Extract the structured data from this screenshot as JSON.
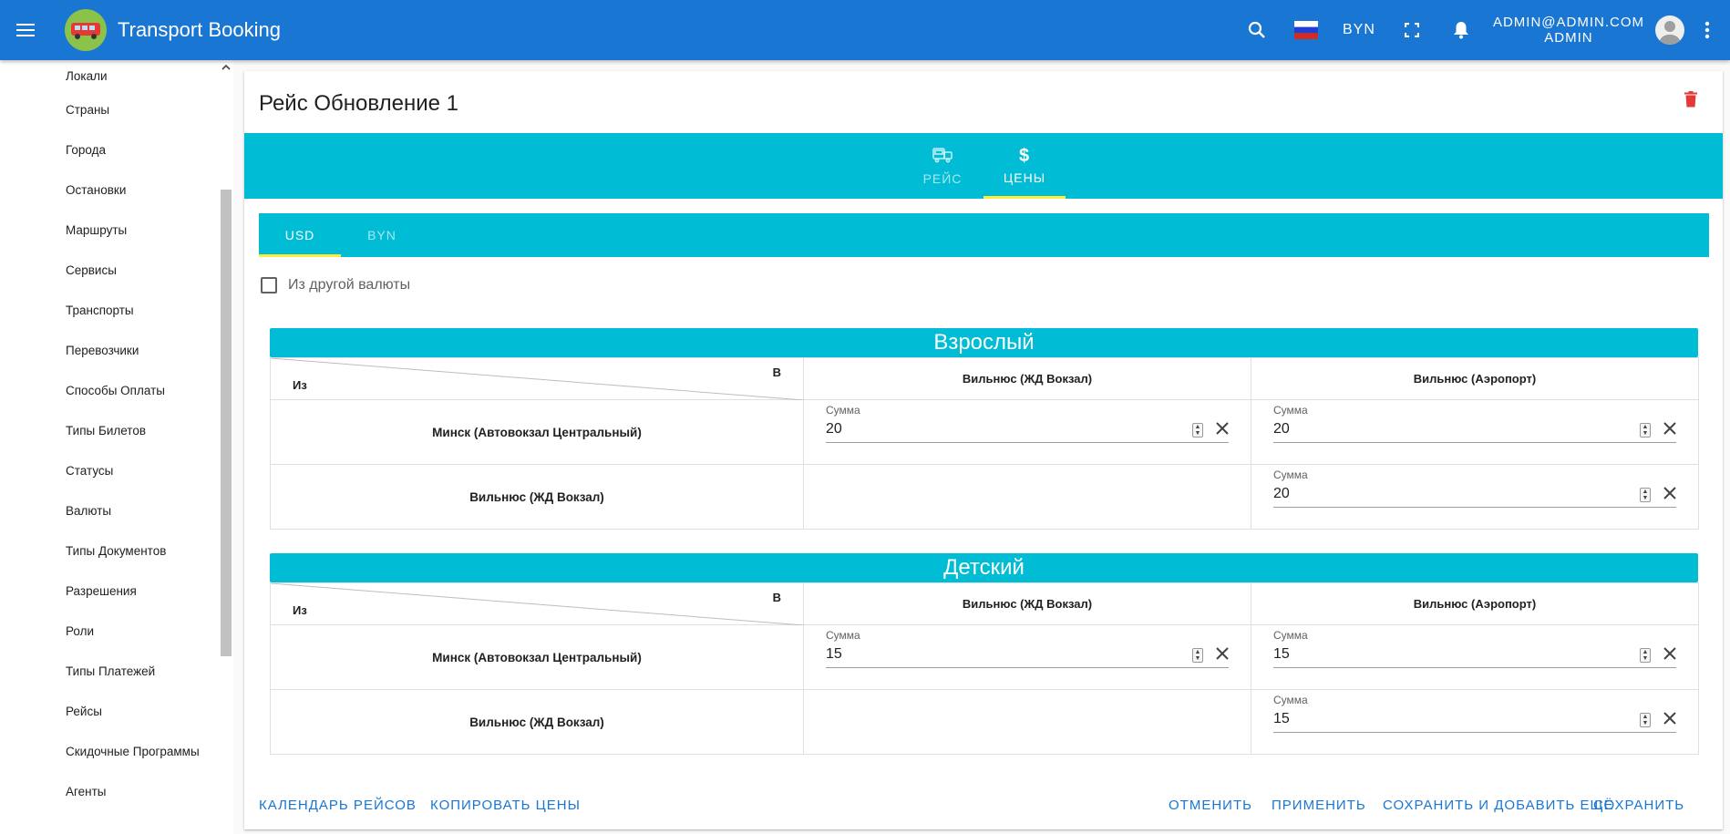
{
  "appbar": {
    "title": "Transport Booking",
    "currency": "BYN",
    "user_email": "ADMIN@ADMIN.COM",
    "user_role": "ADMIN",
    "color": "#1976d2"
  },
  "sidebar": {
    "items": [
      {
        "label": "Локали"
      },
      {
        "label": "Страны"
      },
      {
        "label": "Города"
      },
      {
        "label": "Остановки"
      },
      {
        "label": "Маршруты"
      },
      {
        "label": "Сервисы"
      },
      {
        "label": "Транспорты"
      },
      {
        "label": "Перевозчики"
      },
      {
        "label": "Способы Оплаты"
      },
      {
        "label": "Типы Билетов"
      },
      {
        "label": "Статусы"
      },
      {
        "label": "Валюты"
      },
      {
        "label": "Типы Документов"
      },
      {
        "label": "Разрешения"
      },
      {
        "label": "Роли"
      },
      {
        "label": "Типы Платежей"
      },
      {
        "label": "Рейсы"
      },
      {
        "label": "Скидочные Программы"
      },
      {
        "label": "Агенты"
      }
    ]
  },
  "page": {
    "title": "Рейс Обновление 1",
    "accent": "#00bcd4",
    "ink_color": "#ffeb3b",
    "delete_color": "#e53935"
  },
  "main_tabs": [
    {
      "label": "РЕЙС",
      "icon": "bus-icon",
      "active": false
    },
    {
      "label": "ЦЕНЫ",
      "icon": "dollar-icon",
      "active": true
    }
  ],
  "currency_tabs": [
    {
      "label": "USD",
      "active": true
    },
    {
      "label": "BYN",
      "active": false
    }
  ],
  "from_other_currency": {
    "label": "Из другой валюты",
    "checked": false
  },
  "price_sections": [
    {
      "title": "Взрослый",
      "from_label": "Из",
      "to_label": "В",
      "columns": [
        "Вильнюс (ЖД Вокзал)",
        "Вильнюс (Аэропорт)"
      ],
      "rows": [
        {
          "label": "Минск (Автовокзал Центральный)",
          "cells": [
            {
              "field_label": "Сумма",
              "value": "20"
            },
            {
              "field_label": "Сумма",
              "value": "20"
            }
          ]
        },
        {
          "label": "Вильнюс (ЖД Вокзал)",
          "cells": [
            null,
            {
              "field_label": "Сумма",
              "value": "20"
            }
          ]
        }
      ]
    },
    {
      "title": "Детский",
      "from_label": "Из",
      "to_label": "В",
      "columns": [
        "Вильнюс (ЖД Вокзал)",
        "Вильнюс (Аэропорт)"
      ],
      "rows": [
        {
          "label": "Минск (Автовокзал Центральный)",
          "cells": [
            {
              "field_label": "Сумма",
              "value": "15"
            },
            {
              "field_label": "Сумма",
              "value": "15"
            }
          ]
        },
        {
          "label": "Вильнюс (ЖД Вокзал)",
          "cells": [
            null,
            {
              "field_label": "Сумма",
              "value": "15"
            }
          ]
        }
      ]
    }
  ],
  "actions": {
    "calendar": "КАЛЕНДАРЬ РЕЙСОВ",
    "copy_prices": "КОПИРОВАТЬ ЦЕНЫ",
    "cancel": "ОТМЕНИТЬ",
    "apply": "ПРИМЕНИТЬ",
    "save_add": "СОХРАНИТЬ И ДОБАВИТЬ ЕЩЁ",
    "save": "СОХРАНИТЬ"
  }
}
